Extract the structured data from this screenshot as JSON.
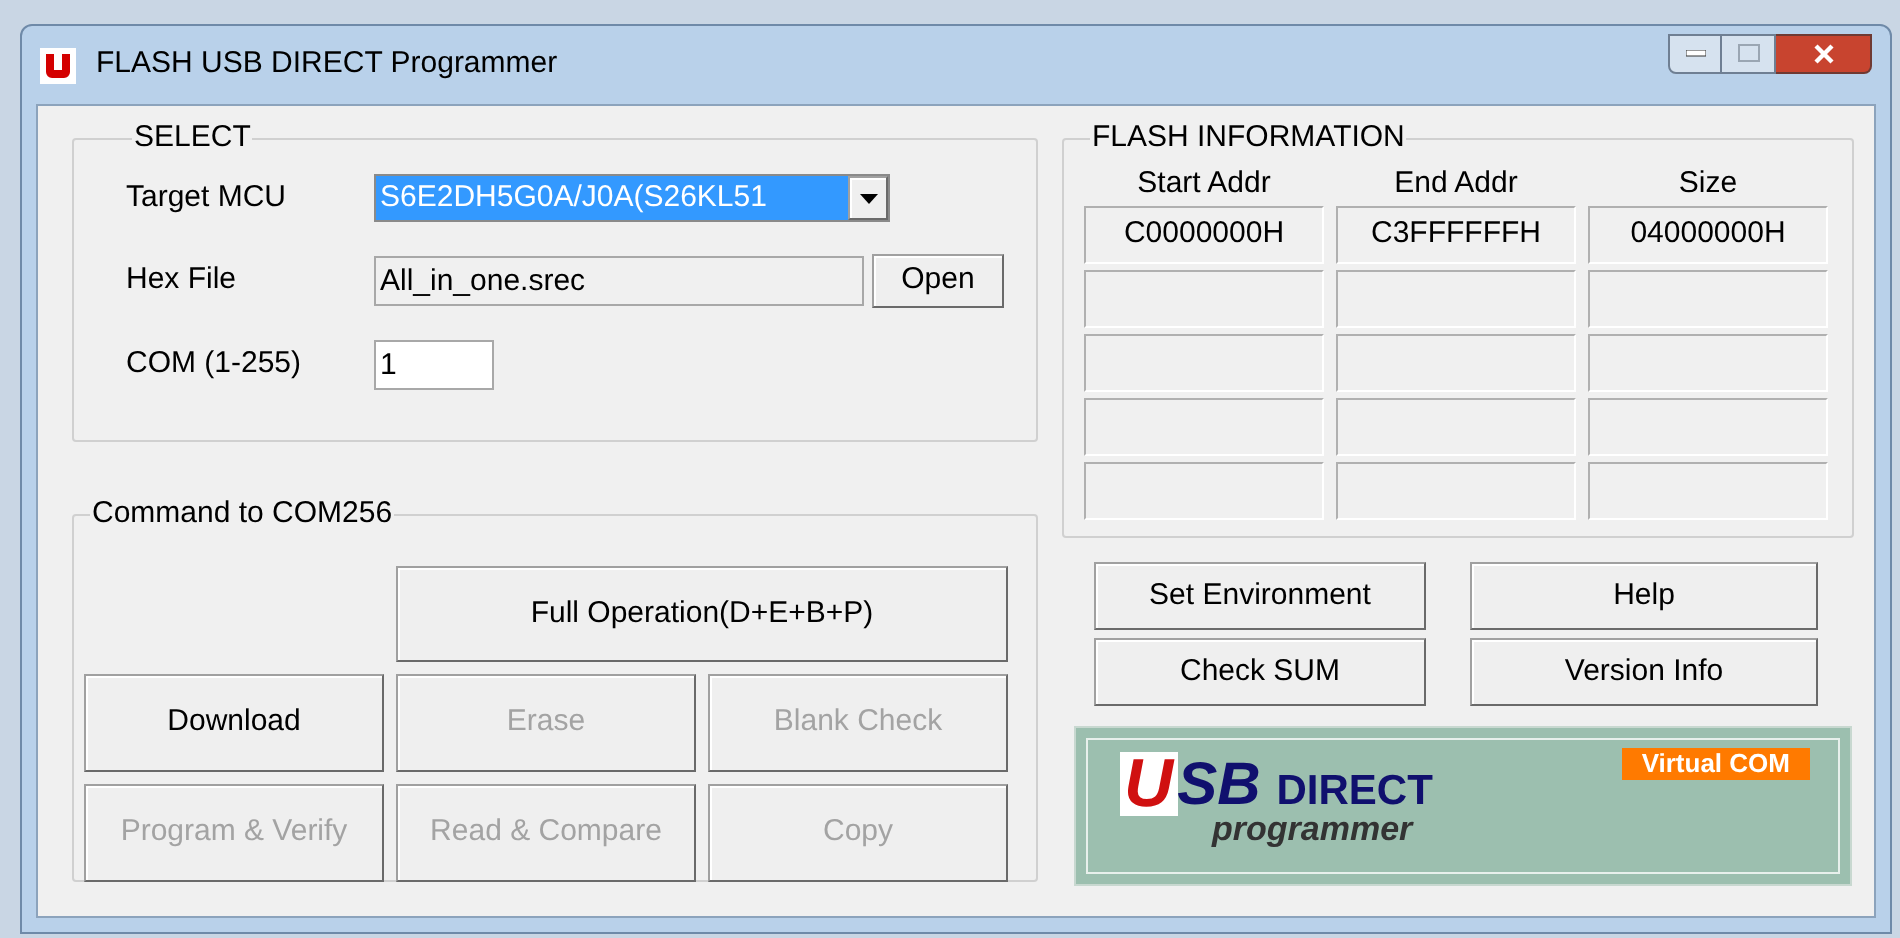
{
  "window": {
    "title": "FLASH USB DIRECT Programmer"
  },
  "select": {
    "title": "SELECT",
    "target_mcu": {
      "label": "Target MCU",
      "value": "S6E2DH5G0A/J0A(S26KL51"
    },
    "hex_file": {
      "label": "Hex File",
      "value": "All_in_one.srec",
      "button": "Open"
    },
    "com": {
      "label": "COM (1-255)",
      "value": "1"
    }
  },
  "flash_information": {
    "title": "FLASH INFORMATION",
    "columns": [
      "Start Addr",
      "End Addr",
      "Size"
    ],
    "rows": [
      [
        "C0000000H",
        "C3FFFFFFH",
        "04000000H"
      ]
    ]
  },
  "command": {
    "title": "Command  to  COM256",
    "buttons": [
      {
        "label": "Full Operation(D+E+B+P)",
        "disabled": false
      },
      {
        "label": "Download",
        "disabled": false
      },
      {
        "label": "Erase",
        "disabled": true
      },
      {
        "label": "Blank Check",
        "disabled": true
      },
      {
        "label": "Program & Verify",
        "disabled": true
      },
      {
        "label": "Read & Compare",
        "disabled": true
      },
      {
        "label": "Copy",
        "disabled": true
      }
    ]
  },
  "side_buttons": [
    "Set Environment",
    "Help",
    "Check SUM",
    "Version Info"
  ],
  "logo": {
    "initial": "U",
    "rest": "SB",
    "word": "DIRECT",
    "tagline": "programmer",
    "badge": "Virtual COM"
  }
}
